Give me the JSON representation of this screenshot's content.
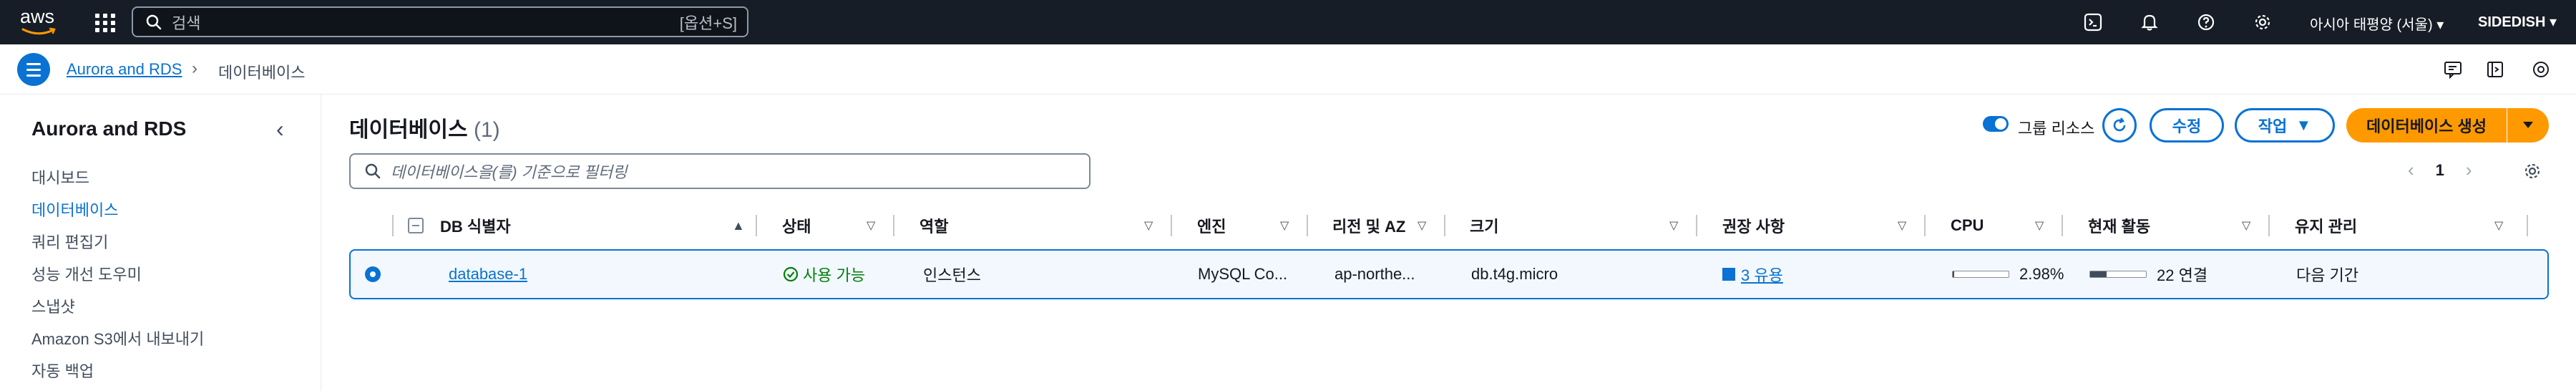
{
  "topnav": {
    "logo_text": "aws",
    "search_placeholder": "검색",
    "search_shortcut": "[옵션+S]",
    "region": "아시아 태평양 (서울)",
    "account": "SIDEDISH",
    "icons": [
      "cloudshell-icon",
      "bell-icon",
      "help-icon",
      "gear-icon"
    ]
  },
  "breadcrumb": {
    "parent": "Aurora and RDS",
    "separator": "›",
    "current": "데이터베이스"
  },
  "sidebar": {
    "title": "Aurora and RDS",
    "items": [
      {
        "label": "대시보드",
        "active": false
      },
      {
        "label": "데이터베이스",
        "active": true
      },
      {
        "label": "쿼리 편집기",
        "active": false
      },
      {
        "label": "성능 개선 도우미",
        "active": false
      },
      {
        "label": "스냅샷",
        "active": false
      },
      {
        "label": "Amazon S3에서 내보내기",
        "active": false
      },
      {
        "label": "자동 백업",
        "active": false
      }
    ]
  },
  "main": {
    "title": "데이터베이스",
    "count": "(1)",
    "group_resources_label": "그룹 리소스",
    "modify_label": "수정",
    "actions_label": "작업",
    "create_label": "데이터베이스 생성",
    "filter_placeholder": "데이터베이스을(를) 기준으로 필터링",
    "page_number": "1"
  },
  "table": {
    "columns": [
      "DB 식별자",
      "상태",
      "역할",
      "엔진",
      "리전 및 AZ",
      "크기",
      "권장 사항",
      "CPU",
      "현재 활동",
      "유지 관리"
    ],
    "rows": [
      {
        "identifier": "database-1",
        "status": "사용 가능",
        "role": "인스턴스",
        "engine": "MySQL Co...",
        "region_az": "ap-northe...",
        "size": "db.t4g.micro",
        "recommendations": "3 유용",
        "cpu_text": "2.98%",
        "cpu_fraction": 0.0298,
        "activity_text": "22 연결",
        "activity_fraction": 0.3,
        "maintenance": "다음 기간"
      }
    ]
  },
  "colors": {
    "nav_bg": "#161d26",
    "accent": "#0972d3",
    "primary_button": "#ff9900",
    "success": "#037f0c"
  }
}
